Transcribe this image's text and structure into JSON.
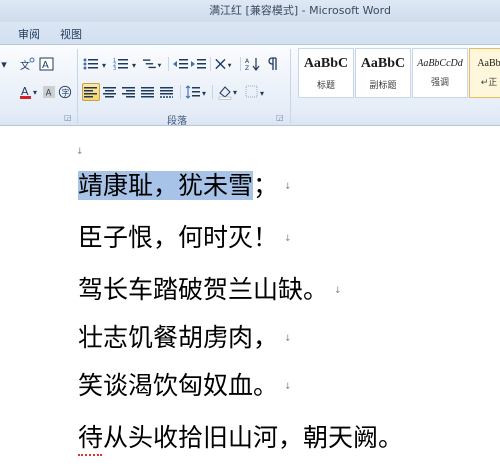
{
  "window": {
    "title": "满江红 [兼容模式] - Microsoft Word"
  },
  "tabs": [
    "审阅",
    "视图"
  ],
  "ribbon": {
    "paragraph_group_label": "段落",
    "styles": [
      {
        "sample": "AaBbC",
        "name": "标题"
      },
      {
        "sample": "AaBbC",
        "name": "副标题"
      },
      {
        "sample": "AaBbCcDd",
        "name": "强调"
      },
      {
        "sample": "AaBb",
        "name": "正"
      }
    ]
  },
  "document": {
    "paragraph_mark": "↓",
    "lines": [
      {
        "highlighted": "靖康耻，犹未雪",
        "text": "；",
        "mark": "↓"
      },
      {
        "highlighted": "",
        "text": "臣子恨，何时灭！",
        "mark": "↓"
      },
      {
        "highlighted": "",
        "text": "驾长车踏破贺兰山缺。",
        "mark": "↓"
      },
      {
        "highlighted": "",
        "text": "壮志饥餐胡虏肉，",
        "mark": "↓"
      },
      {
        "highlighted": "",
        "text": "笑谈渴饮匈奴血。",
        "mark": "↓"
      },
      {
        "highlighted": "",
        "text": "待从头收拾旧山河，朝天阙。",
        "mark": ""
      }
    ]
  }
}
